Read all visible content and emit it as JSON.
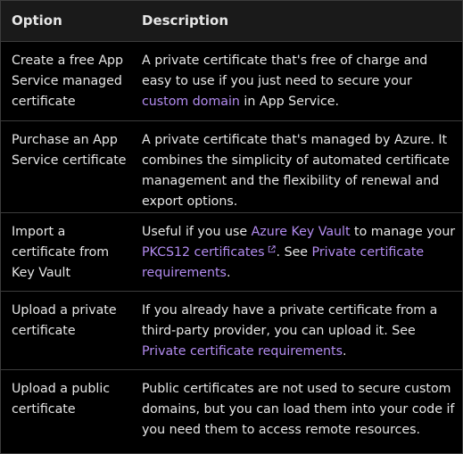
{
  "header": {
    "option": "Option",
    "description": "Description"
  },
  "rows": [
    {
      "option": "Create a free App Service managed certificate",
      "desc_1": "A private certificate that's free of charge and easy to use if you just need to secure your ",
      "link_1": "custom domain",
      "desc_2": " in App Service."
    },
    {
      "option": "Purchase an App Service certificate",
      "desc_1": "A private certificate that's managed by Azure. It combines the simplicity of automated certificate management and the flexibility of renewal and export options."
    },
    {
      "option": "Import a certificate from Key Vault",
      "desc_1": "Useful if you use ",
      "link_1": "Azure Key Vault",
      "desc_2": " to manage your ",
      "link_2": "PKCS12 certificates",
      "desc_3": ". See ",
      "link_3": "Private certificate requirements",
      "desc_4": "."
    },
    {
      "option": "Upload a private certificate",
      "desc_1": "If you already have a private certificate from a third-party provider, you can upload it. See ",
      "link_1": "Private certificate requirements",
      "desc_2": "."
    },
    {
      "option": "Upload a public certificate",
      "desc_1": "Public certificates are not used to secure custom domains, but you can load them into your code if you need them to access remote resources."
    }
  ],
  "colors": {
    "background": "#000000",
    "header_background": "#1a1a1a",
    "border": "#3c3c3c",
    "text": "#e6e6e6",
    "link": "#b38cf0"
  },
  "icons": {
    "external_link": "external-link-icon"
  }
}
